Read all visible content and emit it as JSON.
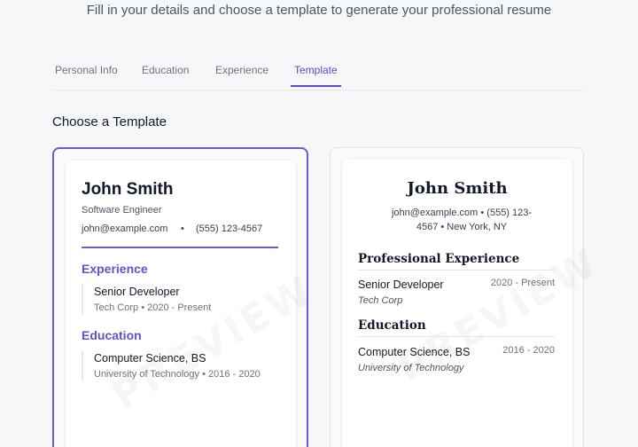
{
  "header": {
    "subtitle": "Fill in your details and choose a template to generate your professional resume"
  },
  "tabs": [
    {
      "label": "Personal Info"
    },
    {
      "label": "Education"
    },
    {
      "label": "Experience"
    },
    {
      "label": "Template",
      "active": true
    }
  ],
  "section": {
    "title": "Choose a Template"
  },
  "colors": {
    "accent": "#6150cf",
    "selected_border": "#6b5cd6"
  },
  "templates": {
    "modern": {
      "selected": true,
      "watermark": "PREVIEW",
      "name": "John Smith",
      "role": "Software Engineer",
      "email": "john@example.com",
      "separator": "•",
      "phone": "(555) 123-4567",
      "experience_heading": "Experience",
      "job_title": "Senior Developer",
      "job_meta": "Tech Corp • 2020 - Present",
      "education_heading": "Education",
      "degree": "Computer Science, BS",
      "school_meta": "University of Technology • 2016 - 2020"
    },
    "classic": {
      "selected": false,
      "watermark": "PREVIEW",
      "name": "John Smith",
      "contact_line1": "john@example.com  •  (555) 123-",
      "contact_line2": "4567  •  New York, NY",
      "experience_heading": "Professional Experience",
      "job_title": "Senior Developer",
      "job_company": "Tech Corp",
      "job_dates": "2020 - Present",
      "education_heading": "Education",
      "degree": "Computer Science, BS",
      "school": "University of Technology",
      "school_dates": "2016 - 2020"
    }
  }
}
